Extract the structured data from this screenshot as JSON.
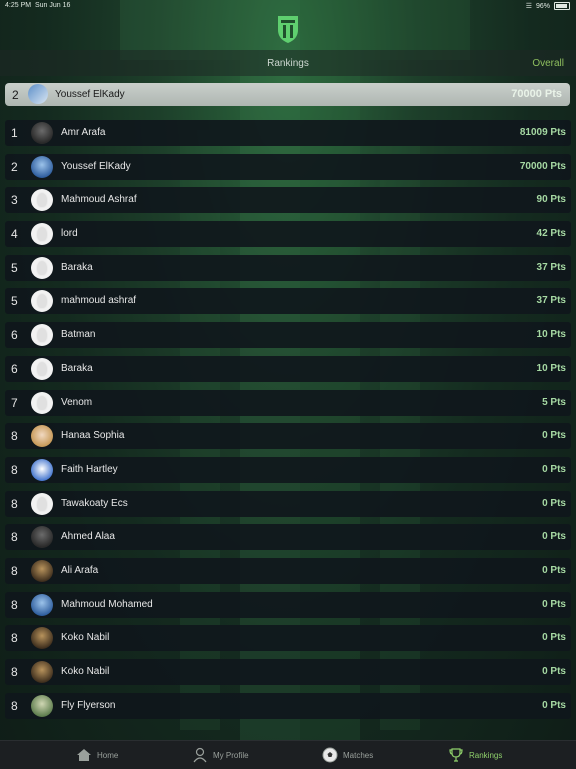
{
  "status": {
    "time": "4:25 PM",
    "date": "Sun Jun 16",
    "battery": "96%"
  },
  "header": {
    "title": "Rankings",
    "overall": "Overall"
  },
  "current_user": {
    "rank": "2",
    "name": "Youssef ElKady",
    "points": "70000 Pts"
  },
  "rankings": [
    {
      "rank": "1",
      "name": "Amr Arafa",
      "points": "81009 Pts",
      "avatar": "dark-photo"
    },
    {
      "rank": "2",
      "name": "Youssef ElKady",
      "points": "70000 Pts",
      "avatar": "blue-photo"
    },
    {
      "rank": "3",
      "name": "Mahmoud Ashraf",
      "points": "90 Pts",
      "avatar": "default"
    },
    {
      "rank": "4",
      "name": "lord",
      "points": "42 Pts",
      "avatar": "default"
    },
    {
      "rank": "5",
      "name": "Baraka",
      "points": "37 Pts",
      "avatar": "default"
    },
    {
      "rank": "5",
      "name": "mahmoud ashraf",
      "points": "37 Pts",
      "avatar": "default"
    },
    {
      "rank": "6",
      "name": "Batman",
      "points": "10 Pts",
      "avatar": "default"
    },
    {
      "rank": "6",
      "name": "Baraka",
      "points": "10 Pts",
      "avatar": "default"
    },
    {
      "rank": "7",
      "name": "Venom",
      "points": "5 Pts",
      "avatar": "default"
    },
    {
      "rank": "8",
      "name": "Hanaa Sophia",
      "points": "0 Pts",
      "avatar": "blonde-photo"
    },
    {
      "rank": "8",
      "name": "Faith Hartley",
      "points": "0 Pts",
      "avatar": "cartoon-photo"
    },
    {
      "rank": "8",
      "name": "Tawakoaty Ecs",
      "points": "0 Pts",
      "avatar": "default"
    },
    {
      "rank": "8",
      "name": "Ahmed Alaa",
      "points": "0 Pts",
      "avatar": "dark-photo"
    },
    {
      "rank": "8",
      "name": "Ali Arafa",
      "points": "0 Pts",
      "avatar": "brown-photo"
    },
    {
      "rank": "8",
      "name": "Mahmoud Mohamed",
      "points": "0 Pts",
      "avatar": "blue-photo"
    },
    {
      "rank": "8",
      "name": "Koko Nabil",
      "points": "0 Pts",
      "avatar": "brown-photo"
    },
    {
      "rank": "8",
      "name": "Koko Nabil",
      "points": "0 Pts",
      "avatar": "brown-photo"
    },
    {
      "rank": "8",
      "name": "Fly Flyerson",
      "points": "0 Pts",
      "avatar": "green-photo"
    }
  ],
  "tabs": [
    {
      "label": "Home",
      "icon": "home-icon"
    },
    {
      "label": "My Profile",
      "icon": "person-icon"
    },
    {
      "label": "Matches",
      "icon": "soccer-ball-icon"
    },
    {
      "label": "Rankings",
      "icon": "trophy-icon"
    }
  ],
  "colors": {
    "accent": "#8fd06b",
    "points": "#a6d9a3",
    "overall": "#8fbf5f"
  }
}
